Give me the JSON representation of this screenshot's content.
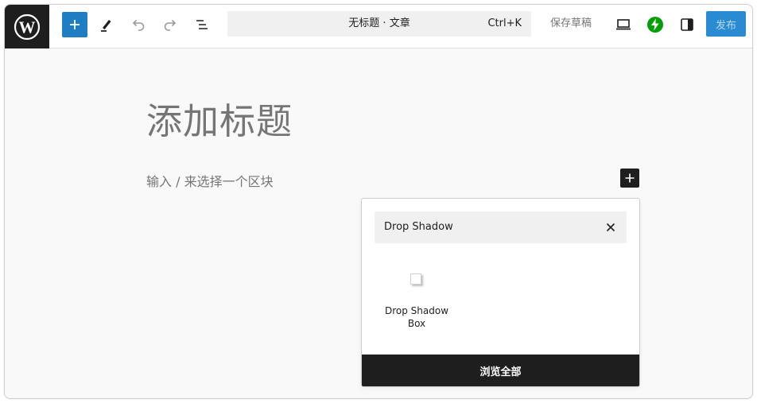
{
  "toolbar": {
    "document_title": "无标题 · 文章",
    "shortcut": "Ctrl+K",
    "save_draft_label": "保存草稿",
    "publish_label": "发布",
    "icons": {
      "logo": "wordpress-logo-icon",
      "add": "plus-icon",
      "tools": "pencil-icon",
      "undo": "undo-icon",
      "redo": "redo-icon",
      "outline": "list-view-icon",
      "preview": "laptop-icon",
      "jetpack": "jetpack-bolt-icon",
      "settings": "sidebar-toggle-icon"
    }
  },
  "editor": {
    "title_placeholder": "添加标题",
    "block_placeholder": "输入 / 来选择一个区块"
  },
  "inserter": {
    "search_value": "Drop Shadow",
    "results": [
      {
        "label": "Drop Shadow Box",
        "icon": "drop-shadow-box-icon"
      }
    ],
    "browse_all_label": "浏览全部"
  },
  "colors": {
    "accent": "#1f7ec3",
    "publish_disabled": "#2a8bd2",
    "dark": "#1e1e1e",
    "jetpack_green": "#069e08"
  }
}
